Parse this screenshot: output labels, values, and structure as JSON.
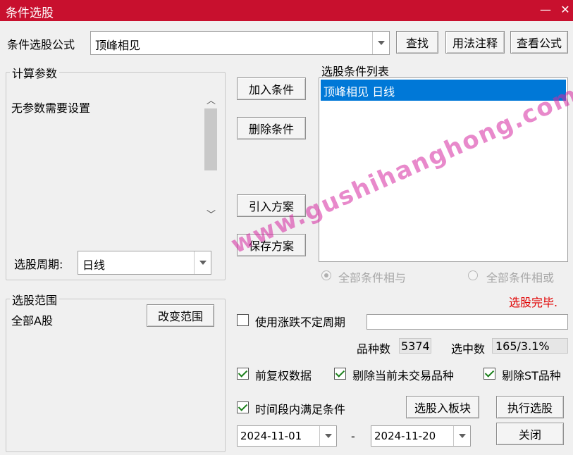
{
  "window": {
    "title": "条件选股",
    "minimize": "—",
    "close": "✕"
  },
  "formula": {
    "label": "条件选股公式",
    "value": "顶峰相见"
  },
  "buttons": {
    "find": "查找",
    "usage": "用法注释",
    "view_formula": "查看公式",
    "add_condition": "加入条件",
    "delete_condition": "删除条件",
    "import_plan": "引入方案",
    "save_plan": "保存方案",
    "change_range": "改变范围",
    "to_block": "选股入板块",
    "execute": "执行选股",
    "close": "关闭"
  },
  "params": {
    "legend": "计算参数",
    "message": "无参数需要设置",
    "period_label": "选股周期:",
    "period_value": "日线"
  },
  "conditions": {
    "title": "选股条件列表",
    "items": [
      "顶峰相见  日线"
    ],
    "radio_and": "全部条件相与",
    "radio_or": "全部条件相或"
  },
  "range": {
    "legend": "选股范围",
    "value": "全部A股"
  },
  "status": {
    "text": "选股完毕.",
    "color": "#e00000"
  },
  "options": {
    "variable_period": "使用涨跌不定周期",
    "fq": "前复权数据",
    "exclude_no_trade": "剔除当前未交易品种",
    "exclude_st": "剔除ST品种",
    "time_range": "时间段内满足条件"
  },
  "stats": {
    "count_label": "品种数",
    "count_value": "5374",
    "selected_label": "选中数",
    "selected_value": "165/3.1%"
  },
  "dates": {
    "start": "2024-11-01",
    "separator": "-",
    "end": "2024-11-20"
  },
  "watermark": "www.gushihanghong.com",
  "colors": {
    "titlebar": "#c8102e",
    "selection": "#0078d7"
  }
}
